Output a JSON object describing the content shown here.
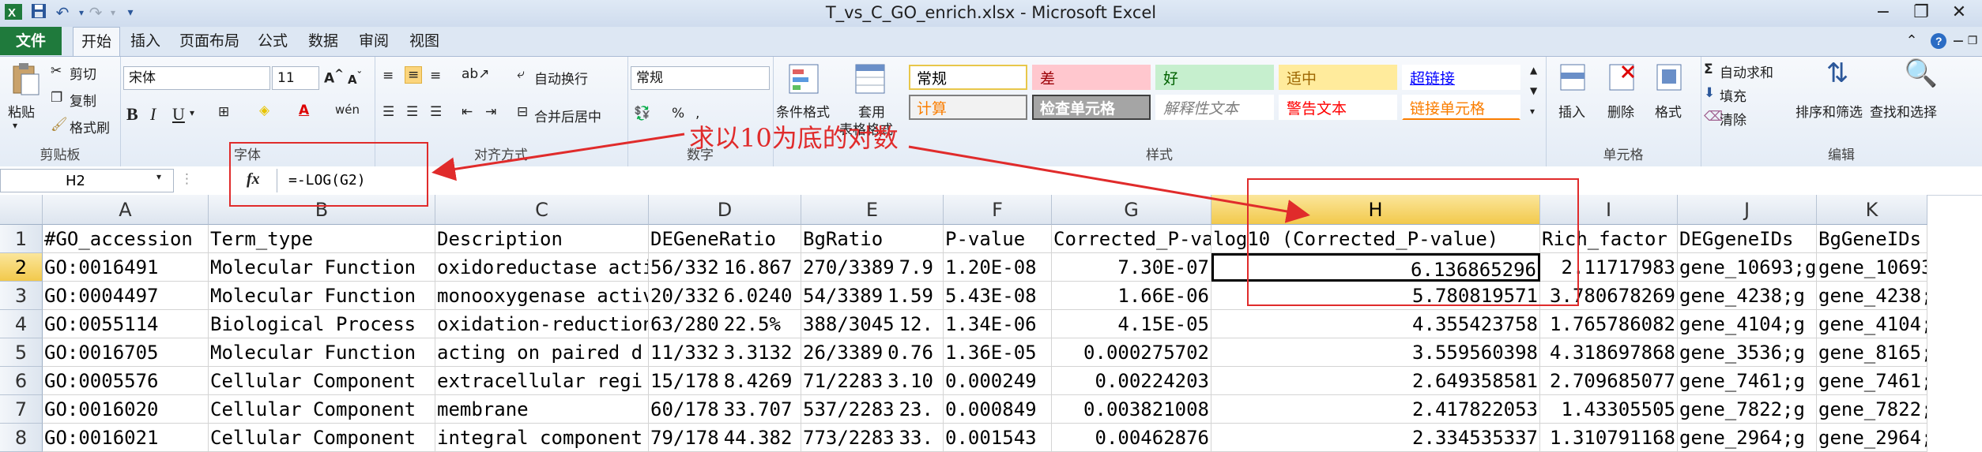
{
  "window": {
    "title": "T_vs_C_GO_enrich.xlsx - Microsoft Excel",
    "minimize": "−",
    "restore": "❐",
    "close": "✕"
  },
  "ribbon_tabs": [
    "文件",
    "开始",
    "插入",
    "页面布局",
    "公式",
    "数据",
    "审阅",
    "视图"
  ],
  "clipboard": {
    "paste": "粘贴",
    "cut": "剪切",
    "copy": "复制",
    "format_painter": "格式刷",
    "group": "剪贴板"
  },
  "font": {
    "name": "宋体",
    "size": "11",
    "bold": "B",
    "italic": "I",
    "underline": "U",
    "group": "字体"
  },
  "alignment": {
    "wrap": "自动换行",
    "merge": "合并后居中",
    "group": "对齐方式"
  },
  "number": {
    "format": "常规",
    "percent": "%",
    "comma": ",",
    "group": "数字"
  },
  "styles": {
    "conditional": "条件格式",
    "as_table": "套用",
    "as_table2": "表格格式",
    "cells": [
      {
        "label": "常规",
        "bg": "#ffffff",
        "fg": "#000000",
        "border": "#e8c74a"
      },
      {
        "label": "差",
        "bg": "#ffc7ce",
        "fg": "#9c0006",
        "border": "#ffc7ce"
      },
      {
        "label": "好",
        "bg": "#c6efce",
        "fg": "#006100",
        "border": "#c6efce"
      },
      {
        "label": "适中",
        "bg": "#ffeb9c",
        "fg": "#9c6500",
        "border": "#ffeb9c"
      },
      {
        "label": "超链接",
        "bg": "#ffffff",
        "fg": "#0000ff",
        "border": "#ffffff"
      },
      {
        "label": "计算",
        "bg": "#f2f2f2",
        "fg": "#fa7d00",
        "border": "#7f7f7f"
      },
      {
        "label": "检查单元格",
        "bg": "#a5a5a5",
        "fg": "#ffffff",
        "border": "#3f3f3f"
      },
      {
        "label": "解释性文本",
        "bg": "#ffffff",
        "fg": "#7f7f7f",
        "border": "#ffffff"
      },
      {
        "label": "警告文本",
        "bg": "#ffffff",
        "fg": "#ff0000",
        "border": "#ffffff"
      },
      {
        "label": "链接单元格",
        "bg": "#ffffff",
        "fg": "#fa7d00",
        "border": "#ffffff"
      }
    ],
    "group": "样式"
  },
  "cells_group": {
    "insert": "插入",
    "delete": "删除",
    "format": "格式",
    "group": "单元格"
  },
  "editing": {
    "autosum": "自动求和",
    "fill": "填充",
    "clear": "清除",
    "sort": "排序和筛选",
    "find": "查找和选择",
    "group": "编辑"
  },
  "formula_bar": {
    "namebox": "H2",
    "fx": "fx",
    "formula": "=-LOG(G2)"
  },
  "annotation": "求以10为底的对数",
  "columns": [
    "A",
    "B",
    "C",
    "D",
    "E",
    "F",
    "G",
    "H",
    "I",
    "J",
    "K"
  ],
  "rows": [
    [
      "#GO_accession",
      "Term_type",
      "Description",
      "DEGeneRatio",
      "BgRatio",
      "P-value",
      "Corrected_P-value",
      "log10 (Corrected_P-value)",
      "Rich_factor",
      "DEGgeneIDs",
      "BgGeneIDs"
    ],
    [
      "GO:0016491",
      "Molecular Function",
      "oxidoreductase activity",
      "56/332",
      "16.867",
      "270/3389",
      "7.9",
      "1.20E-08",
      "7.30E-07",
      "6.136865296",
      "2.11717983",
      "gene_10693;g",
      "gene_10693"
    ],
    [
      "GO:0004497",
      "Molecular Function",
      "monooxygenase activity",
      "20/332",
      "6.0240",
      "54/3389",
      "1.59",
      "5.43E-08",
      "1.66E-06",
      "5.780819571",
      "3.780678269",
      "gene_4238;g",
      "gene_4238;"
    ],
    [
      "GO:0055114",
      "Biological Process",
      "oxidation-reduction",
      "63/280",
      "22.5%",
      "388/3045",
      "12.",
      "1.34E-06",
      "4.15E-05",
      "4.355423758",
      "1.765786082",
      "gene_4104;g",
      "gene_4104;"
    ],
    [
      "GO:0016705",
      "Molecular Function",
      "acting on paired d",
      "11/332",
      "3.3132",
      "26/3389",
      "0.76",
      "1.36E-05",
      "0.000275702",
      "3.559560398",
      "4.318697868",
      "gene_3536;g",
      "gene_8165;"
    ],
    [
      "GO:0005576",
      "Cellular Component",
      "extracellular regi",
      "15/178",
      "8.4269",
      "71/2283",
      "3.10",
      "0.000249",
      "0.00224203",
      "2.649358581",
      "2.709685077",
      "gene_7461;g",
      "gene_7461;"
    ],
    [
      "GO:0016020",
      "Cellular Component",
      "membrane",
      "60/178",
      "33.707",
      "537/2283",
      "23.",
      "0.000849",
      "0.003821008",
      "2.417822053",
      "1.43305505",
      "gene_7822;g",
      "gene_7822;"
    ],
    [
      "GO:0016021",
      "Cellular Component",
      "integral component",
      "79/178",
      "44.382",
      "773/2283",
      "33.",
      "0.001543",
      "0.00462876",
      "2.334535337",
      "1.310791168",
      "gene_2964;g",
      "gene_2964;"
    ]
  ]
}
